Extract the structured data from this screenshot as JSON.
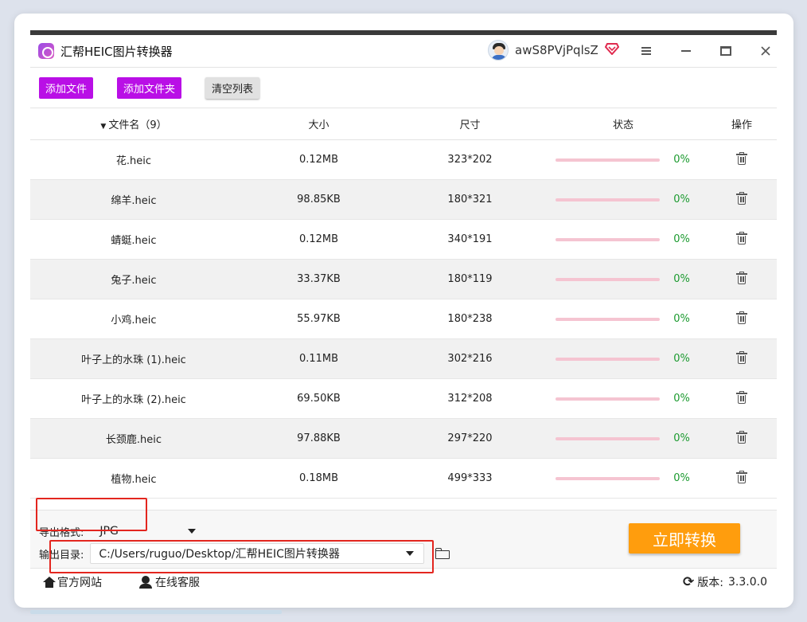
{
  "app": {
    "title": "汇帮HEIC图片转换器",
    "username": "awS8PVjPqlsZ"
  },
  "toolbar": {
    "add_file": "添加文件",
    "add_folder": "添加文件夹",
    "clear_list": "清空列表"
  },
  "table": {
    "headers": {
      "name": "文件名（9）",
      "size": "大小",
      "dims": "尺寸",
      "status": "状态",
      "op": "操作"
    },
    "rows": [
      {
        "name": "花.heic",
        "size": "0.12MB",
        "dims": "323*202",
        "progress": "0%"
      },
      {
        "name": "绵羊.heic",
        "size": "98.85KB",
        "dims": "180*321",
        "progress": "0%"
      },
      {
        "name": "蜻蜓.heic",
        "size": "0.12MB",
        "dims": "340*191",
        "progress": "0%"
      },
      {
        "name": "兔子.heic",
        "size": "33.37KB",
        "dims": "180*119",
        "progress": "0%"
      },
      {
        "name": "小鸡.heic",
        "size": "55.97KB",
        "dims": "180*238",
        "progress": "0%"
      },
      {
        "name": "叶子上的水珠 (1).heic",
        "size": "0.11MB",
        "dims": "302*216",
        "progress": "0%"
      },
      {
        "name": "叶子上的水珠 (2).heic",
        "size": "69.50KB",
        "dims": "312*208",
        "progress": "0%"
      },
      {
        "name": "长颈鹿.heic",
        "size": "97.88KB",
        "dims": "297*220",
        "progress": "0%"
      },
      {
        "name": "植物.heic",
        "size": "0.18MB",
        "dims": "499*333",
        "progress": "0%"
      }
    ]
  },
  "settings": {
    "format_label": "导出格式:",
    "format_value": "JPG",
    "dir_label": "输出目录:",
    "dir_value": "C:/Users/ruguo/Desktop/汇帮HEIC图片转换器",
    "convert_button": "立即转换"
  },
  "footer": {
    "website": "官方网站",
    "service": "在线客服",
    "version_label": "版本:",
    "version_value": "3.3.0.0"
  },
  "colors": {
    "accent_purple": "#b90fe6",
    "convert_orange": "#ff9d0d",
    "progress_track": "#f5c4d1",
    "percent_green": "#1a9a2e",
    "annotation_red": "#e3261f"
  }
}
